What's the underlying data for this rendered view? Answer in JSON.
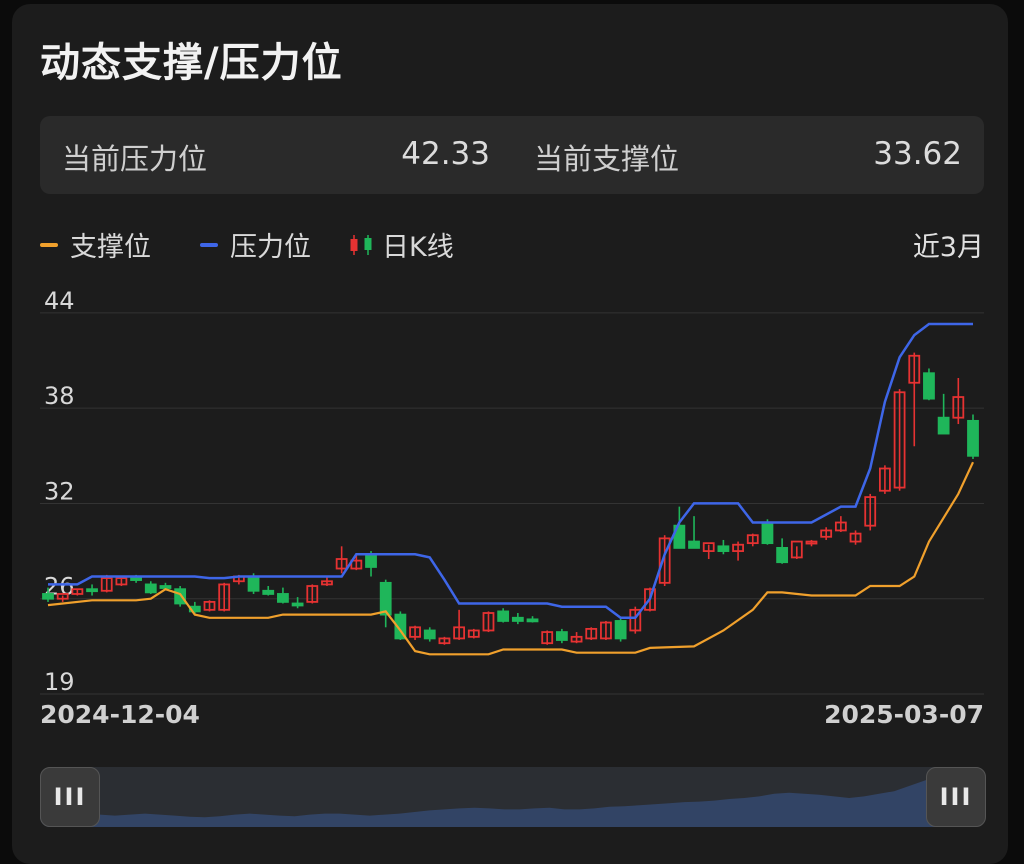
{
  "header": {
    "title": "动态支撑/压力位"
  },
  "stats": {
    "resistance_label": "当前压力位",
    "resistance_value": "42.33",
    "support_label": "当前支撑位",
    "support_value": "33.62"
  },
  "legend": {
    "support": "支撑位",
    "resistance": "压力位",
    "kline": "日K线",
    "period": "近3月"
  },
  "colors": {
    "support": "#f0a02c",
    "resistance": "#3e66e8",
    "up": "#e63232",
    "down": "#1fb65a",
    "grid": "#333333"
  },
  "slider": {
    "handle_glyph": "III"
  },
  "chart_data": {
    "type": "candlestick",
    "x_start": "2024-12-04",
    "x_end": "2025-03-07",
    "ylim": [
      19,
      44
    ],
    "y_ticks": [
      "19",
      "26",
      "32",
      "38",
      "44"
    ],
    "y_tick_values": [
      19,
      25,
      31,
      37,
      43
    ],
    "candles": [
      [
        25.3,
        25.7,
        24.8,
        25.0
      ],
      [
        25.0,
        25.2,
        24.8,
        25.3
      ],
      [
        25.3,
        25.6,
        25.2,
        25.6
      ],
      [
        25.6,
        25.9,
        25.2,
        25.5
      ],
      [
        25.5,
        26.5,
        25.4,
        26.3
      ],
      [
        25.9,
        26.4,
        25.8,
        26.3
      ],
      [
        26.3,
        26.5,
        26.0,
        26.2
      ],
      [
        25.9,
        26.1,
        25.3,
        25.4
      ],
      [
        25.8,
        26.0,
        25.6,
        25.7
      ],
      [
        25.6,
        25.8,
        24.5,
        24.7
      ],
      [
        24.5,
        24.8,
        24.0,
        24.2
      ],
      [
        24.3,
        24.9,
        24.2,
        24.8
      ],
      [
        24.3,
        26.0,
        24.2,
        25.9
      ],
      [
        26.1,
        26.5,
        25.9,
        26.4
      ],
      [
        26.4,
        26.6,
        25.3,
        25.5
      ],
      [
        25.5,
        25.8,
        25.2,
        25.3
      ],
      [
        25.3,
        25.7,
        24.7,
        24.8
      ],
      [
        24.7,
        25.1,
        24.4,
        24.6
      ],
      [
        24.8,
        25.9,
        24.7,
        25.8
      ],
      [
        25.9,
        26.4,
        25.8,
        26.1
      ],
      [
        26.9,
        28.3,
        26.6,
        27.5
      ],
      [
        26.9,
        27.8,
        26.8,
        27.4
      ],
      [
        27.8,
        28.0,
        26.4,
        27.0
      ],
      [
        26.0,
        26.2,
        23.2,
        24.0
      ],
      [
        24.0,
        24.2,
        22.4,
        22.5
      ],
      [
        22.6,
        23.3,
        22.4,
        23.2
      ],
      [
        23.0,
        23.2,
        22.3,
        22.5
      ],
      [
        22.2,
        22.6,
        22.1,
        22.5
      ],
      [
        22.5,
        24.3,
        22.4,
        23.2
      ],
      [
        22.6,
        23.1,
        22.5,
        23.0
      ],
      [
        23.0,
        24.2,
        22.9,
        24.1
      ],
      [
        24.2,
        24.4,
        23.5,
        23.6
      ],
      [
        23.8,
        24.1,
        23.4,
        23.6
      ],
      [
        23.7,
        23.9,
        23.5,
        23.6
      ],
      [
        22.2,
        23.0,
        22.1,
        22.9
      ],
      [
        22.9,
        23.1,
        22.2,
        22.4
      ],
      [
        22.3,
        22.9,
        22.2,
        22.6
      ],
      [
        22.5,
        23.2,
        22.4,
        23.1
      ],
      [
        22.5,
        23.6,
        22.4,
        23.5
      ],
      [
        23.6,
        23.8,
        22.3,
        22.5
      ],
      [
        23.0,
        24.5,
        22.8,
        24.3
      ],
      [
        24.3,
        25.7,
        24.2,
        25.6
      ],
      [
        26.0,
        29.0,
        25.8,
        28.8
      ],
      [
        29.6,
        30.8,
        29.3,
        28.2
      ],
      [
        28.6,
        30.2,
        28.2,
        28.2
      ],
      [
        28.0,
        28.4,
        27.5,
        28.5
      ],
      [
        28.3,
        28.7,
        27.8,
        28.0
      ],
      [
        28.0,
        28.6,
        27.4,
        28.4
      ],
      [
        28.5,
        29.1,
        28.3,
        29.0
      ],
      [
        29.8,
        30.0,
        28.4,
        28.5
      ],
      [
        28.2,
        28.8,
        27.2,
        27.3
      ],
      [
        27.6,
        28.3,
        27.5,
        28.6
      ],
      [
        28.5,
        28.7,
        28.3,
        28.6
      ],
      [
        28.9,
        29.5,
        28.7,
        29.3
      ],
      [
        29.3,
        30.2,
        29.2,
        29.8
      ],
      [
        28.6,
        29.3,
        28.4,
        29.1
      ],
      [
        29.6,
        31.6,
        29.3,
        31.4
      ],
      [
        31.8,
        33.4,
        31.6,
        33.2
      ],
      [
        32.0,
        38.2,
        31.8,
        38.0
      ],
      [
        38.6,
        40.5,
        34.6,
        40.3
      ],
      [
        39.2,
        39.5,
        37.5,
        37.6
      ],
      [
        36.4,
        37.9,
        35.8,
        35.4
      ],
      [
        36.4,
        38.9,
        36.0,
        37.7
      ],
      [
        36.2,
        36.6,
        33.8,
        34.0
      ]
    ],
    "support": [
      [
        0,
        24.6
      ],
      [
        3,
        24.9
      ],
      [
        6,
        24.9
      ],
      [
        7,
        25.0
      ],
      [
        8,
        25.6
      ],
      [
        9,
        25.3
      ],
      [
        10,
        24.0
      ],
      [
        11,
        23.8
      ],
      [
        15,
        23.8
      ],
      [
        16,
        24.0
      ],
      [
        20,
        24.0
      ],
      [
        22,
        24.0
      ],
      [
        23,
        24.2
      ],
      [
        24,
        23.0
      ],
      [
        25,
        21.7
      ],
      [
        26,
        21.5
      ],
      [
        30,
        21.5
      ],
      [
        31,
        21.8
      ],
      [
        35,
        21.8
      ],
      [
        36,
        21.6
      ],
      [
        40,
        21.6
      ],
      [
        41,
        21.9
      ],
      [
        44,
        22.0
      ],
      [
        46,
        23.0
      ],
      [
        48,
        24.3
      ],
      [
        49,
        25.4
      ],
      [
        50,
        25.4
      ],
      [
        52,
        25.2
      ],
      [
        55,
        25.2
      ],
      [
        56,
        25.8
      ],
      [
        58,
        25.8
      ],
      [
        59,
        26.4
      ],
      [
        60,
        28.6
      ],
      [
        62,
        31.6
      ],
      [
        63,
        33.6
      ]
    ],
    "resistance": [
      [
        0,
        25.9
      ],
      [
        2,
        25.9
      ],
      [
        3,
        26.4
      ],
      [
        10,
        26.4
      ],
      [
        11,
        26.3
      ],
      [
        12,
        26.3
      ],
      [
        13,
        26.4
      ],
      [
        20,
        26.4
      ],
      [
        21,
        27.8
      ],
      [
        25,
        27.8
      ],
      [
        26,
        27.6
      ],
      [
        27,
        26.2
      ],
      [
        28,
        24.7
      ],
      [
        34,
        24.7
      ],
      [
        35,
        24.5
      ],
      [
        38,
        24.5
      ],
      [
        39,
        23.8
      ],
      [
        40,
        23.8
      ],
      [
        41,
        25.0
      ],
      [
        42,
        27.8
      ],
      [
        43,
        29.8
      ],
      [
        44,
        31.0
      ],
      [
        47,
        31.0
      ],
      [
        48,
        29.8
      ],
      [
        51,
        29.8
      ],
      [
        52,
        29.8
      ],
      [
        54,
        30.8
      ],
      [
        55,
        30.8
      ],
      [
        56,
        33.2
      ],
      [
        57,
        37.4
      ],
      [
        58,
        40.2
      ],
      [
        59,
        41.6
      ],
      [
        60,
        42.3
      ],
      [
        63,
        42.3
      ]
    ],
    "volume_profile": [
      0.15,
      0.18,
      0.2,
      0.22,
      0.2,
      0.18,
      0.2,
      0.22,
      0.2,
      0.18,
      0.16,
      0.15,
      0.17,
      0.2,
      0.22,
      0.2,
      0.18,
      0.17,
      0.2,
      0.22,
      0.22,
      0.2,
      0.18,
      0.2,
      0.22,
      0.25,
      0.28,
      0.3,
      0.32,
      0.33,
      0.32,
      0.3,
      0.3,
      0.32,
      0.33,
      0.3,
      0.3,
      0.32,
      0.35,
      0.36,
      0.38,
      0.4,
      0.42,
      0.44,
      0.45,
      0.47,
      0.5,
      0.52,
      0.55,
      0.6,
      0.62,
      0.6,
      0.58,
      0.55,
      0.52,
      0.55,
      0.6,
      0.65,
      0.75,
      0.85,
      0.95,
      1.0,
      0.95,
      0.85
    ]
  }
}
